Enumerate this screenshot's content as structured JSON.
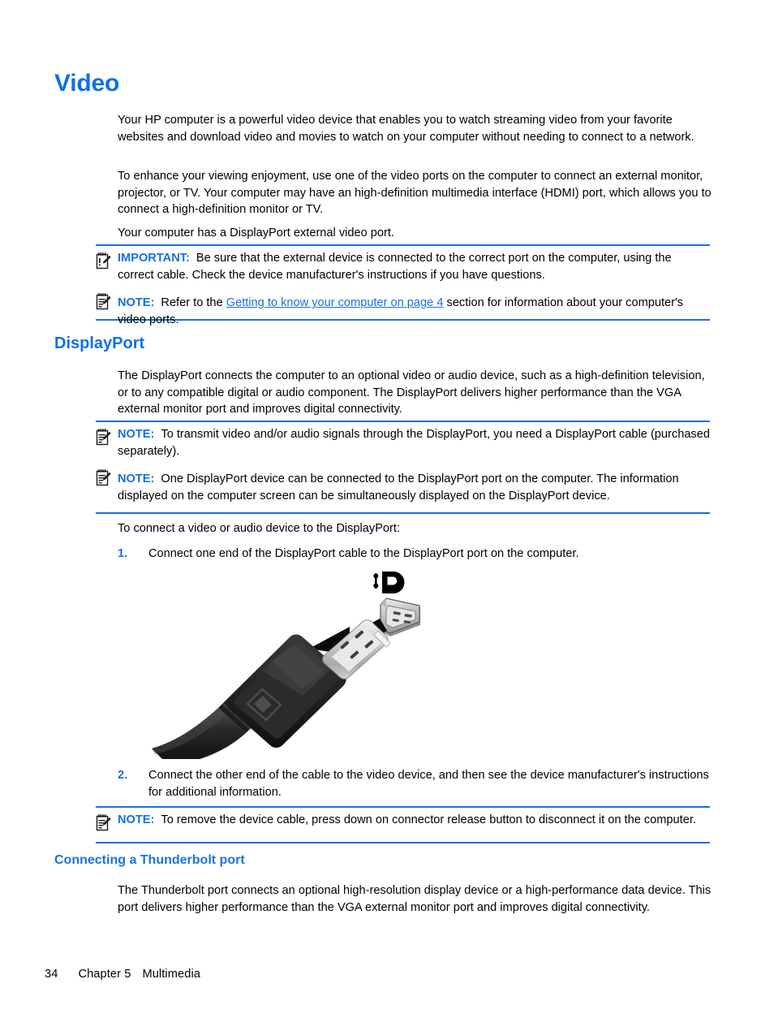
{
  "document": {
    "title": "Video"
  },
  "sections": {
    "video": {
      "heading": "Video",
      "paragraphs": [
        "Your HP computer is a powerful video device that enables you to watch streaming video from your favorite websites and download video and movies to watch on your computer without needing to connect to a network.",
        "To enhance your viewing enjoyment, use one of the video ports on the computer to connect an external monitor, projector, or TV. Your computer may have an high-definition multimedia interface (HDMI) port, which allows you to connect a high-definition monitor or TV.",
        "Your computer has a DisplayPort external video port."
      ]
    },
    "displayport": {
      "heading": "DisplayPort",
      "paragraph": "The DisplayPort connects the computer to an optional video or audio device, such as a high-definition television, or to any compatible digital or audio component. The DisplayPort delivers higher performance than the VGA external monitor port and improves digital connectivity.",
      "intro": "To connect a video or audio device to the DisplayPort:"
    },
    "thunderbolt": {
      "heading": "Connecting a Thunderbolt port",
      "paragraph": "The Thunderbolt port connects an optional high-resolution display device or a high-performance data device. This port delivers higher performance than the VGA external monitor port and improves digital connectivity."
    }
  },
  "callouts": {
    "group1": [
      {
        "icon": "important-notepad-icon",
        "label": "IMPORTANT:",
        "text": "Be sure that the external device is connected to the correct port on the computer, using the correct cable. Check the device manufacturer's instructions if you have questions."
      }
    ],
    "group1b": [
      {
        "icon": "note-notepad-icon",
        "label": "NOTE:",
        "text_before": "Refer to the",
        "link": "Getting to know your computer on page 4",
        "text_after": "section for information about your computer's video ports."
      }
    ],
    "group2": [
      {
        "icon": "note-notepad-icon",
        "label": "NOTE:",
        "text": "To transmit video and/or audio signals through the DisplayPort, you need a DisplayPort cable (purchased separately)."
      },
      {
        "icon": "note-notepad-icon",
        "label": "NOTE:",
        "text": "One DisplayPort device can be connected to the DisplayPort port on the computer. The information displayed on the computer screen can be simultaneously displayed on the DisplayPort device."
      }
    ],
    "group3": [
      {
        "icon": "note-notepad-icon",
        "label": "NOTE:",
        "text": "To remove the device cable, press down on connector release button to disconnect it on the computer."
      }
    ]
  },
  "steps": [
    {
      "number": "1.",
      "text": "Connect one end of the DisplayPort cable to the DisplayPort port on the computer."
    },
    {
      "number": "2.",
      "text": "Connect the other end of the cable to the video device, and then see the device manufacturer's instructions for additional information."
    }
  ],
  "figure": {
    "name": "displayport-cable-connection-illustration",
    "logo": "displayport-logo",
    "alt": "DisplayPort cable plug being inserted into a DisplayPort receptacle"
  },
  "footer": {
    "page_number": "34",
    "chapter": "Chapter 5",
    "chapter_title": "Multimedia"
  },
  "colors": {
    "heading_blue": "#0f6fe8",
    "accent_blue": "#1a6fe0",
    "link_blue": "#1a6fe0",
    "text_black": "#000000",
    "page_background": "#ffffff"
  }
}
